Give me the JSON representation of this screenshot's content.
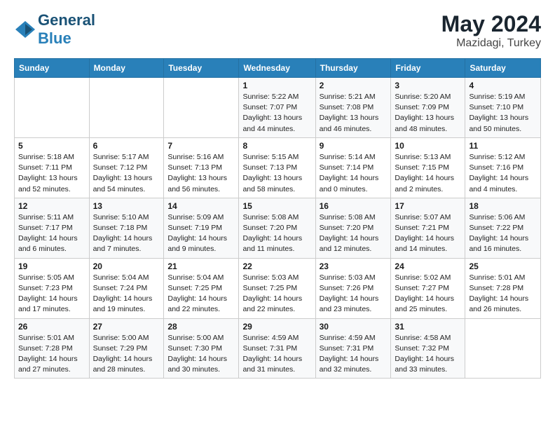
{
  "header": {
    "logo_general": "General",
    "logo_blue": "Blue",
    "title": "May 2024",
    "location": "Mazidagi, Turkey"
  },
  "days_of_week": [
    "Sunday",
    "Monday",
    "Tuesday",
    "Wednesday",
    "Thursday",
    "Friday",
    "Saturday"
  ],
  "weeks": [
    [
      {
        "day": "",
        "info": ""
      },
      {
        "day": "",
        "info": ""
      },
      {
        "day": "",
        "info": ""
      },
      {
        "day": "1",
        "info": "Sunrise: 5:22 AM\nSunset: 7:07 PM\nDaylight: 13 hours\nand 44 minutes."
      },
      {
        "day": "2",
        "info": "Sunrise: 5:21 AM\nSunset: 7:08 PM\nDaylight: 13 hours\nand 46 minutes."
      },
      {
        "day": "3",
        "info": "Sunrise: 5:20 AM\nSunset: 7:09 PM\nDaylight: 13 hours\nand 48 minutes."
      },
      {
        "day": "4",
        "info": "Sunrise: 5:19 AM\nSunset: 7:10 PM\nDaylight: 13 hours\nand 50 minutes."
      }
    ],
    [
      {
        "day": "5",
        "info": "Sunrise: 5:18 AM\nSunset: 7:11 PM\nDaylight: 13 hours\nand 52 minutes."
      },
      {
        "day": "6",
        "info": "Sunrise: 5:17 AM\nSunset: 7:12 PM\nDaylight: 13 hours\nand 54 minutes."
      },
      {
        "day": "7",
        "info": "Sunrise: 5:16 AM\nSunset: 7:13 PM\nDaylight: 13 hours\nand 56 minutes."
      },
      {
        "day": "8",
        "info": "Sunrise: 5:15 AM\nSunset: 7:13 PM\nDaylight: 13 hours\nand 58 minutes."
      },
      {
        "day": "9",
        "info": "Sunrise: 5:14 AM\nSunset: 7:14 PM\nDaylight: 14 hours\nand 0 minutes."
      },
      {
        "day": "10",
        "info": "Sunrise: 5:13 AM\nSunset: 7:15 PM\nDaylight: 14 hours\nand 2 minutes."
      },
      {
        "day": "11",
        "info": "Sunrise: 5:12 AM\nSunset: 7:16 PM\nDaylight: 14 hours\nand 4 minutes."
      }
    ],
    [
      {
        "day": "12",
        "info": "Sunrise: 5:11 AM\nSunset: 7:17 PM\nDaylight: 14 hours\nand 6 minutes."
      },
      {
        "day": "13",
        "info": "Sunrise: 5:10 AM\nSunset: 7:18 PM\nDaylight: 14 hours\nand 7 minutes."
      },
      {
        "day": "14",
        "info": "Sunrise: 5:09 AM\nSunset: 7:19 PM\nDaylight: 14 hours\nand 9 minutes."
      },
      {
        "day": "15",
        "info": "Sunrise: 5:08 AM\nSunset: 7:20 PM\nDaylight: 14 hours\nand 11 minutes."
      },
      {
        "day": "16",
        "info": "Sunrise: 5:08 AM\nSunset: 7:20 PM\nDaylight: 14 hours\nand 12 minutes."
      },
      {
        "day": "17",
        "info": "Sunrise: 5:07 AM\nSunset: 7:21 PM\nDaylight: 14 hours\nand 14 minutes."
      },
      {
        "day": "18",
        "info": "Sunrise: 5:06 AM\nSunset: 7:22 PM\nDaylight: 14 hours\nand 16 minutes."
      }
    ],
    [
      {
        "day": "19",
        "info": "Sunrise: 5:05 AM\nSunset: 7:23 PM\nDaylight: 14 hours\nand 17 minutes."
      },
      {
        "day": "20",
        "info": "Sunrise: 5:04 AM\nSunset: 7:24 PM\nDaylight: 14 hours\nand 19 minutes."
      },
      {
        "day": "21",
        "info": "Sunrise: 5:04 AM\nSunset: 7:25 PM\nDaylight: 14 hours\nand 22 minutes."
      },
      {
        "day": "22",
        "info": "Sunrise: 5:03 AM\nSunset: 7:25 PM\nDaylight: 14 hours\nand 22 minutes."
      },
      {
        "day": "23",
        "info": "Sunrise: 5:03 AM\nSunset: 7:26 PM\nDaylight: 14 hours\nand 23 minutes."
      },
      {
        "day": "24",
        "info": "Sunrise: 5:02 AM\nSunset: 7:27 PM\nDaylight: 14 hours\nand 25 minutes."
      },
      {
        "day": "25",
        "info": "Sunrise: 5:01 AM\nSunset: 7:28 PM\nDaylight: 14 hours\nand 26 minutes."
      }
    ],
    [
      {
        "day": "26",
        "info": "Sunrise: 5:01 AM\nSunset: 7:28 PM\nDaylight: 14 hours\nand 27 minutes."
      },
      {
        "day": "27",
        "info": "Sunrise: 5:00 AM\nSunset: 7:29 PM\nDaylight: 14 hours\nand 28 minutes."
      },
      {
        "day": "28",
        "info": "Sunrise: 5:00 AM\nSunset: 7:30 PM\nDaylight: 14 hours\nand 30 minutes."
      },
      {
        "day": "29",
        "info": "Sunrise: 4:59 AM\nSunset: 7:31 PM\nDaylight: 14 hours\nand 31 minutes."
      },
      {
        "day": "30",
        "info": "Sunrise: 4:59 AM\nSunset: 7:31 PM\nDaylight: 14 hours\nand 32 minutes."
      },
      {
        "day": "31",
        "info": "Sunrise: 4:58 AM\nSunset: 7:32 PM\nDaylight: 14 hours\nand 33 minutes."
      },
      {
        "day": "",
        "info": ""
      }
    ]
  ]
}
